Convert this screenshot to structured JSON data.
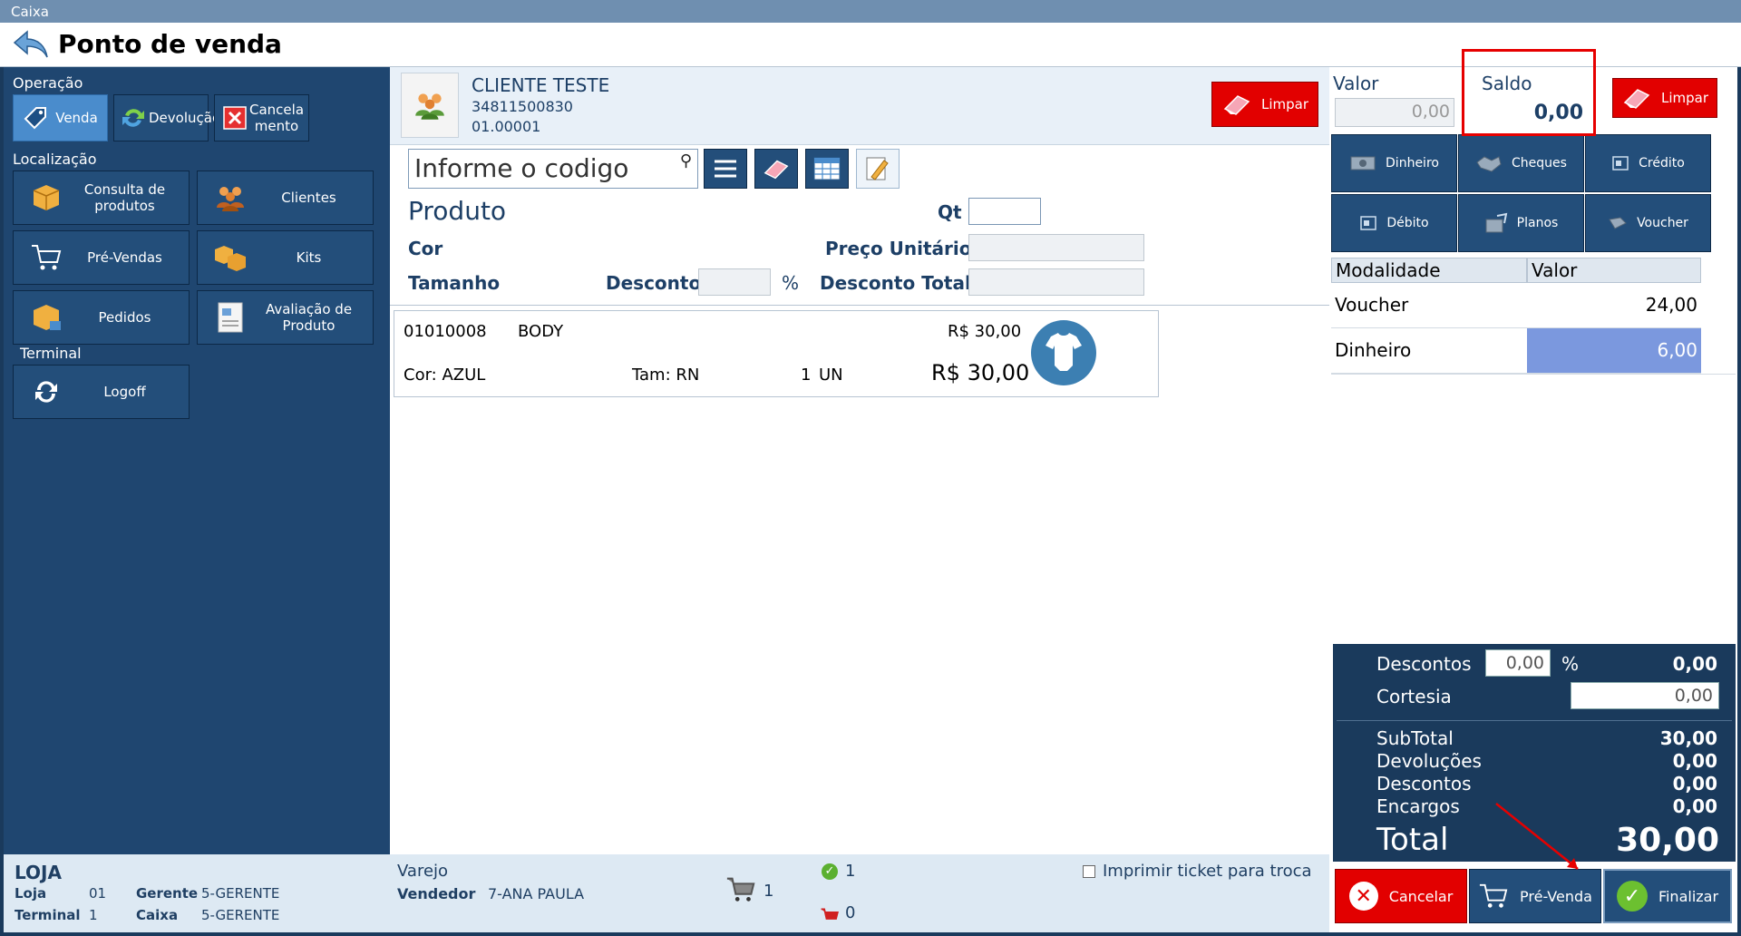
{
  "window": {
    "title": "Caixa",
    "page_title": "Ponto de venda"
  },
  "left": {
    "sections": {
      "operacao": "Operação",
      "localizacao": "Localização",
      "terminal": "Terminal"
    },
    "operacao_buttons": [
      {
        "label": "Venda",
        "icon": "tag-icon",
        "active": true
      },
      {
        "label": "Devolução",
        "icon": "refresh-arrows-icon",
        "active": false
      },
      {
        "label": "Cancela mento",
        "icon": "close-icon",
        "active": false
      }
    ],
    "localizacao_buttons": [
      {
        "label": "Consulta de produtos",
        "icon": "box-icon"
      },
      {
        "label": "Clientes",
        "icon": "people-icon"
      },
      {
        "label": "Pré-Vendas",
        "icon": "cart-icon"
      },
      {
        "label": "Kits",
        "icon": "boxes-icon"
      },
      {
        "label": "Pedidos",
        "icon": "box-cart-icon"
      },
      {
        "label": "Avaliação de Produto",
        "icon": "document-icon"
      }
    ],
    "terminal_buttons": [
      {
        "label": "Logoff",
        "icon": "sync-icon"
      }
    ],
    "info": {
      "heading": "LOJA",
      "loja_label": "Loja",
      "loja_value": "01",
      "gerente_label": "Gerente",
      "gerente_value": "5-GERENTE",
      "terminal_label": "Terminal",
      "terminal_value": "1",
      "caixa_label": "Caixa",
      "caixa_value": "5-GERENTE"
    }
  },
  "client": {
    "name": "CLIENTE TESTE",
    "phone": "34811500830",
    "code": "01.00001",
    "clear_label": "Limpar"
  },
  "search": {
    "placeholder": "Informe o codigo"
  },
  "product_form": {
    "produto_label": "Produto",
    "qt_label": "Qt",
    "cor_label": "Cor",
    "preco_label": "Preço Unitário",
    "tamanho_label": "Tamanho",
    "desconto_label": "Desconto",
    "percent": "%",
    "desconto_total_label": "Desconto Total"
  },
  "items": [
    {
      "code": "01010008",
      "name": "BODY",
      "unit_price": "R$ 30,00",
      "color": "Cor: AZUL",
      "size": "Tam: RN",
      "qty": "1",
      "unit": "UN",
      "total": "R$ 30,00",
      "icon": "baby-bodysuit-icon"
    }
  ],
  "middle_info": {
    "channel": "Varejo",
    "seller_label": "Vendedor",
    "seller_value": "7-ANA PAULA",
    "cart_count": "1",
    "ok_count": "1",
    "pending_count": "0",
    "print_label": "Imprimir ticket para troca"
  },
  "payment": {
    "valor_label": "Valor",
    "valor_value": "0,00",
    "saldo_label": "Saldo",
    "saldo_value": "0,00",
    "clear_label": "Limpar",
    "methods": [
      {
        "label": "Dinheiro",
        "icon": "cash-icon"
      },
      {
        "label": "Cheques",
        "icon": "check-handshake-icon"
      },
      {
        "label": "Crédito",
        "icon": "credit-card-icon"
      },
      {
        "label": "Débito",
        "icon": "debit-card-icon"
      },
      {
        "label": "Planos",
        "icon": "plans-icon"
      },
      {
        "label": "Voucher",
        "icon": "voucher-icon"
      }
    ],
    "grid_headers": {
      "modalidade": "Modalidade",
      "valor": "Valor"
    },
    "rows": [
      {
        "modalidade": "Voucher",
        "valor": "24,00",
        "selected": false
      },
      {
        "modalidade": "Dinheiro",
        "valor": "6,00",
        "selected": true
      }
    ]
  },
  "totals": {
    "descontos_label": "Descontos",
    "descontos_input": "0,00",
    "percent": "%",
    "descontos_value": "0,00",
    "cortesia_label": "Cortesia",
    "cortesia_input": "0,00",
    "subtotal_label": "SubTotal",
    "subtotal_value": "30,00",
    "devolucoes_label": "Devoluções",
    "devolucoes_value": "0,00",
    "descontos2_label": "Descontos",
    "descontos2_value": "0,00",
    "encargos_label": "Encargos",
    "encargos_value": "0,00",
    "total_label": "Total",
    "total_value": "30,00"
  },
  "actions": {
    "cancel_label": "Cancelar",
    "prevenda_label": "Pré-Venda",
    "finalize_label": "Finalizar"
  },
  "colors": {
    "accent_blue": "#234e7a",
    "active_blue": "#4a8ccc",
    "danger_red": "#e20000",
    "selected_row": "#7b98de",
    "panel_dark": "#1a3a5c"
  }
}
